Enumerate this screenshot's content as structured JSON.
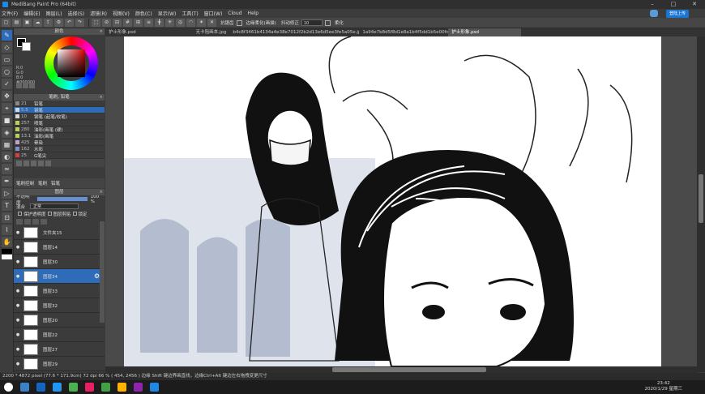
{
  "window": {
    "title": "MediBang Paint Pro (64bit)",
    "minimize": "–",
    "maximize": "□",
    "close": "✕"
  },
  "menu": [
    "文件(F)",
    "编辑(E)",
    "图层(L)",
    "选择(S)",
    "滤镜(R)",
    "视图(V)",
    "颜色(C)",
    "显示(W)",
    "工具(T)",
    "窗口(W)",
    "Cloud",
    "Help"
  ],
  "cloud_button": "登陆上传",
  "toolbar": {
    "antialias_label": "抗锯齿",
    "antialias_value": "5",
    "correction_label": "边缘柔化(画描)",
    "correction2_label": "抖动修正",
    "correction2_value": "10",
    "soft_label": "柔化"
  },
  "doc_tabs": [
    "护士形象.psd",
    "无卡阻画本.jpg",
    "b4c8f3461b4134a4e38e7012f2b2d13e6d5ee3fe5a05e.jpg",
    "1a94e7b8d5f8d1e8a1b4f5dd1b5e00fd4f0d4e3d.jpg (RGB IEC61966-2.1)",
    "护士形象.psd"
  ],
  "color_panel": {
    "title": "颜色",
    "r": "R:0",
    "g": "G:0",
    "b": "B:0",
    "hex": "#000000"
  },
  "brush_panel": {
    "title": "笔刷, 铅笔",
    "items": [
      {
        "size": "21",
        "name": "铅笔",
        "color": "#888888"
      },
      {
        "size": "5.5",
        "name": "钢笔",
        "color": "#d8d8d8"
      },
      {
        "size": "10",
        "name": "钢笔 (起笔/收笔)",
        "color": "#d8d8d8"
      },
      {
        "size": "257",
        "name": "喷笔",
        "color": "#b8d05a"
      },
      {
        "size": "280",
        "name": "油彩(画笔 (硬)",
        "color": "#b8d05a"
      },
      {
        "size": "13.1",
        "name": "油彩(画笔",
        "color": "#b8d05a"
      },
      {
        "size": "425",
        "name": "晕染",
        "color": "#c0a0d0"
      },
      {
        "size": "162",
        "name": "水彩",
        "color": "#8090c0"
      },
      {
        "size": "25",
        "name": "G笔尖",
        "color": "#d04040"
      }
    ]
  },
  "brush_tabs": [
    "笔刷控制",
    "笔刷",
    "铅笔"
  ],
  "layer_panel": {
    "title": "图层",
    "opacity_label": "不透明度",
    "opacity_value": "100 %",
    "blend_label": "混合",
    "blend_value": "正常",
    "protect_label": "保护透明度",
    "clip_label": "图层剪贴",
    "lock_label": "锁定",
    "layers": [
      {
        "name": "文件夹15",
        "selected": false
      },
      {
        "name": "图层14",
        "selected": false
      },
      {
        "name": "图层30",
        "selected": false
      },
      {
        "name": "图层34",
        "selected": true
      },
      {
        "name": "图层33",
        "selected": false
      },
      {
        "name": "图层32",
        "selected": false
      },
      {
        "name": "图层20",
        "selected": false
      },
      {
        "name": "图层22",
        "selected": false
      },
      {
        "name": "图层27",
        "selected": false
      },
      {
        "name": "图层29",
        "selected": false
      }
    ]
  },
  "status": "2200 * 4872 pixel  (77.6 * 171.9cm)  72 dpi  66 %  ( 454, 2456 )  边缘 Shift 键边界画直线，边缘Ctrl+Alt 键边左右拖拽变更尺寸",
  "clock": {
    "time": "23:42",
    "date": "2020/1/29 星期三"
  },
  "colors": {
    "accent": "#2e6bb8",
    "panel": "#3b3b3b"
  }
}
